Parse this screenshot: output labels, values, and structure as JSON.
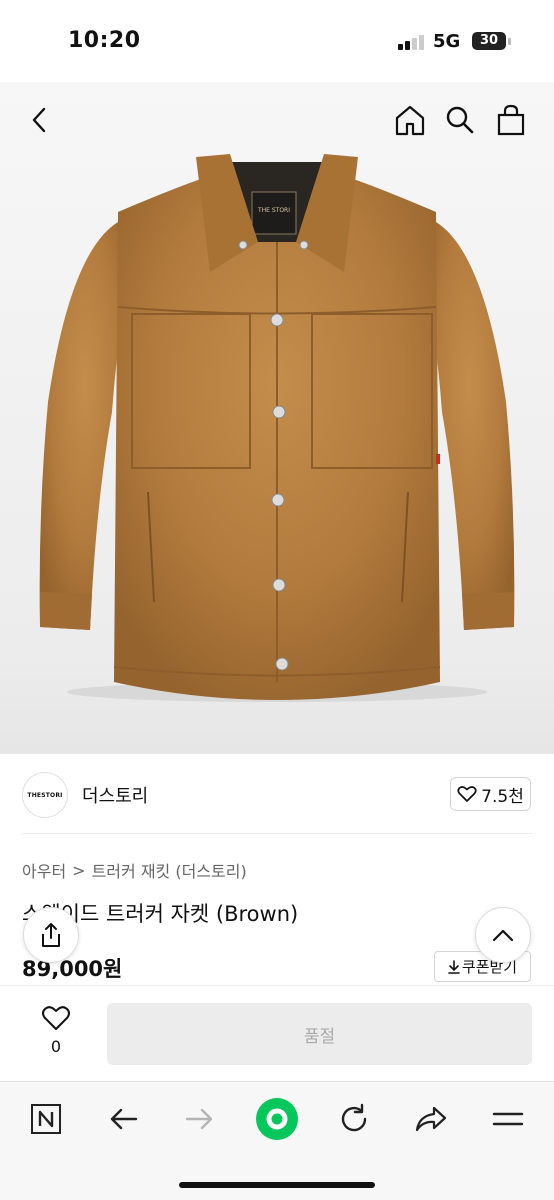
{
  "status_bar": {
    "time": "10:20",
    "network": "5G",
    "battery": "30"
  },
  "product_image": {
    "label_text": "THE STORI",
    "accent": "#b07a3c"
  },
  "seller": {
    "logo_text": "THESTORI",
    "name": "더스토리",
    "likes": "7.5천"
  },
  "breadcrumb": {
    "category": "아우터",
    "separator": ">",
    "subcategory": "트러커 재킷 (더스토리)"
  },
  "product": {
    "title": "스웨이드 트러커 자켓 (Brown)",
    "price": "89,000원",
    "coupon_label": "쿠폰받기"
  },
  "action_bar": {
    "wish_count": "0",
    "soldout_label": "품절"
  },
  "icons": {
    "back": "chevron-left-icon",
    "home": "home-icon",
    "search": "search-icon",
    "cart": "shopping-bag-icon",
    "share": "share-icon",
    "scroll_top": "chevron-up-icon",
    "heart": "heart-icon",
    "download": "download-icon"
  },
  "browser_bar": [
    "naver-n-icon",
    "back-arrow-icon",
    "forward-arrow-icon",
    "green-dot-icon",
    "refresh-icon",
    "share-arrow-icon",
    "menu-icon"
  ],
  "colors": {
    "naver_green": "#03c75a",
    "soldout_bg": "#ececec"
  }
}
